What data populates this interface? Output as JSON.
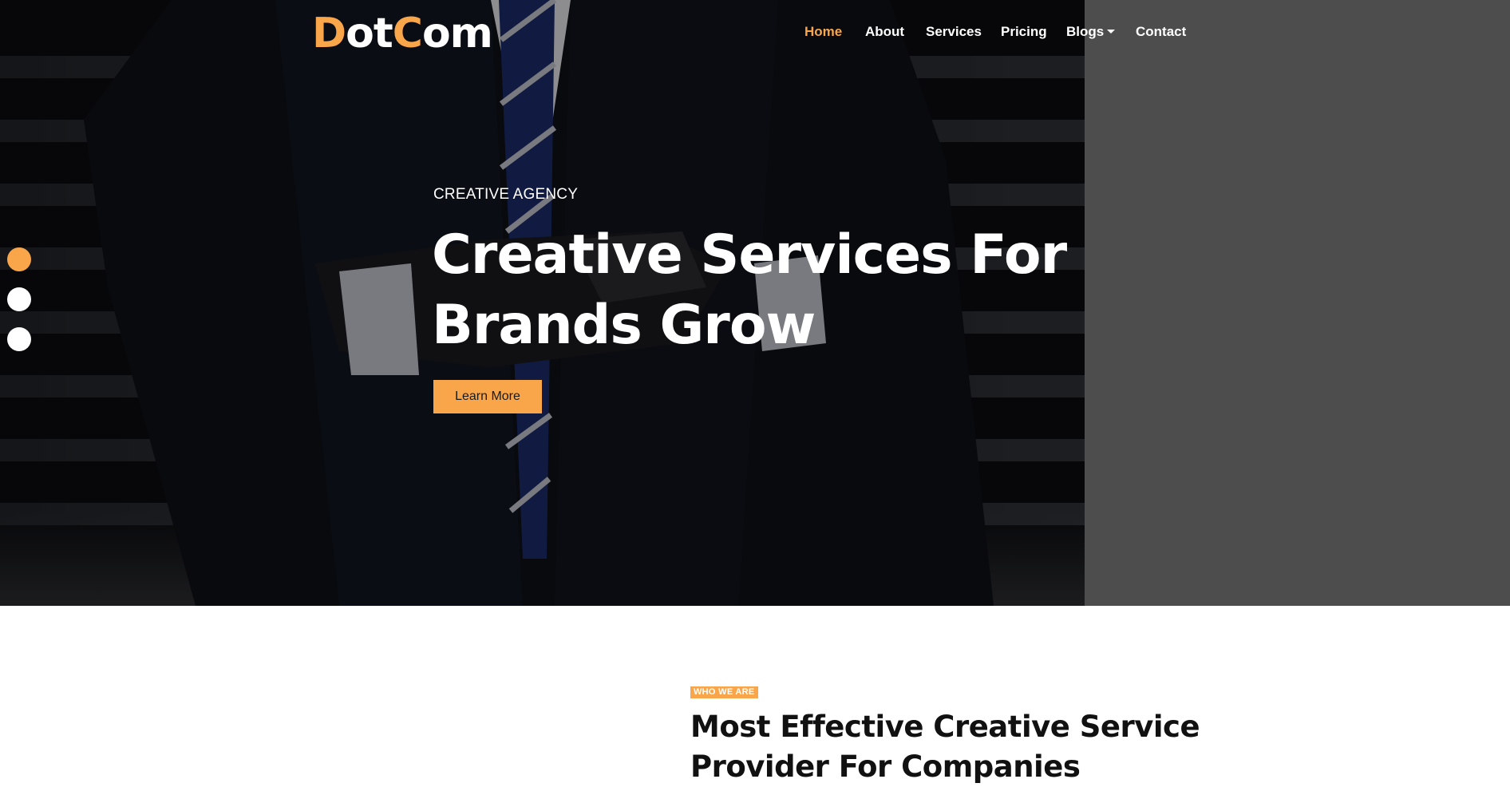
{
  "brand": {
    "logo_first_letter": "D",
    "logo_mid": "ot",
    "logo_second_letter": "C",
    "logo_rest": "om"
  },
  "nav": {
    "items": [
      {
        "label": "Home",
        "active": true
      },
      {
        "label": "About",
        "active": false
      },
      {
        "label": "Services",
        "active": false
      },
      {
        "label": "Pricing",
        "active": false
      },
      {
        "label": "Blogs",
        "active": false,
        "dropdown": true
      },
      {
        "label": "Contact",
        "active": false
      }
    ]
  },
  "hero": {
    "kicker": "CREATIVE AGENCY",
    "headline_line1": "Creative Services For",
    "headline_line2": "Brands Grow",
    "cta_label": "Learn More",
    "slide_dots": {
      "count": 3,
      "active_index": 0
    }
  },
  "about": {
    "tag": "WHO WE ARE",
    "title_line1": "Most Effective Creative Service",
    "title_line2": "Provider For Companies"
  },
  "colors": {
    "accent": "#f9a64a",
    "hero_side_panel": "#4d4d4d",
    "dark_text": "#111111"
  }
}
